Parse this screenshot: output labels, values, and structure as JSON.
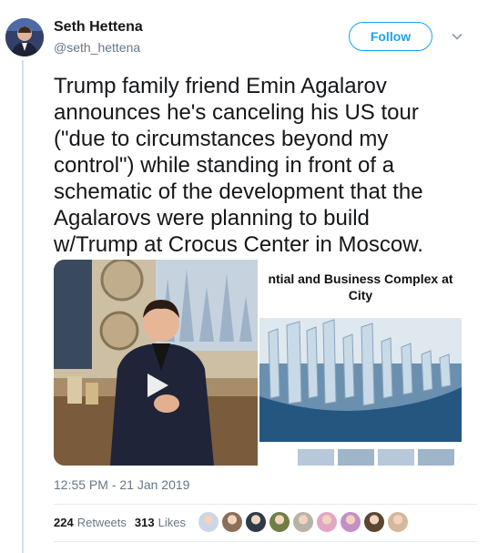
{
  "user": {
    "name": "Seth Hettena",
    "handle": "@seth_hettena",
    "avatar_icon": "profile-photo"
  },
  "follow_label": "Follow",
  "tweet_lines": [
    "Trump family friend Emin Agalarov",
    "announces he's canceling his US tour",
    "(\"due to circumstances beyond my",
    "control\")  while standing in front of a",
    "schematic of the development that the",
    "Agalarovs were planning to build",
    "w/Trump at Crocus Center in Moscow."
  ],
  "media": {
    "right_caption_line1": "ntial and Business Complex at",
    "right_caption_line2": "City"
  },
  "timestamp": "12:55 PM - 21 Jan 2019",
  "stats": {
    "retweets_count": "224",
    "retweets_label": "Retweets",
    "likes_count": "313",
    "likes_label": "Likes"
  },
  "colors": {
    "accent": "#1da1f2",
    "secondary_text": "#657786",
    "thread_line": "#cce0ef"
  },
  "likers": [
    {
      "color": "#c9d7e8"
    },
    {
      "color": "#8a6f5c"
    },
    {
      "color": "#2e3a48"
    },
    {
      "color": "#6e7f46"
    },
    {
      "color": "#b9b2a7"
    },
    {
      "color": "#e2a7c4"
    },
    {
      "color": "#c48ec9"
    },
    {
      "color": "#5a4632"
    },
    {
      "color": "#d4b89c"
    }
  ]
}
